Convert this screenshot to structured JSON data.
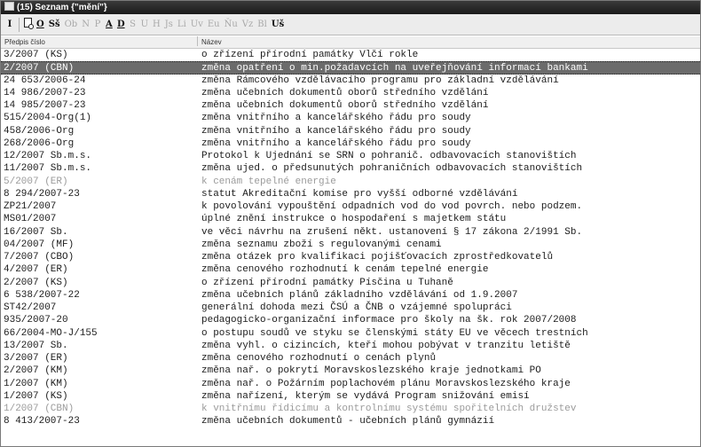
{
  "window": {
    "title": "(15) Seznam {\"mění\"}"
  },
  "toolbar": {
    "buttons": [
      {
        "label": "I",
        "active": true
      },
      {
        "label": "",
        "active": true,
        "icon": "document-search-icon"
      },
      {
        "label": "O",
        "active": true,
        "underline": true
      },
      {
        "label": "Sš",
        "active": true
      },
      {
        "label": "Ob",
        "active": false
      },
      {
        "label": "N",
        "active": false
      },
      {
        "label": "P",
        "active": false
      },
      {
        "label": "A",
        "active": true,
        "underline": true
      },
      {
        "label": "D",
        "active": true,
        "underline": true
      },
      {
        "label": "S",
        "active": false
      },
      {
        "label": "U",
        "active": false
      },
      {
        "label": "H",
        "active": false
      },
      {
        "label": "Js",
        "active": false
      },
      {
        "label": "Li",
        "active": false
      },
      {
        "label": "Uv",
        "active": false
      },
      {
        "label": "Eu",
        "active": false
      },
      {
        "label": "Ňu",
        "active": false
      },
      {
        "label": "Vz",
        "active": false
      },
      {
        "label": "Bl",
        "active": false
      },
      {
        "label": "Uš",
        "active": true
      }
    ]
  },
  "list": {
    "headers": [
      "Předpis číslo",
      "Název"
    ],
    "rows": [
      {
        "number": "3/2007 (KS)",
        "name": "o zřízení přírodní památky Vlčí rokle",
        "state": "normal"
      },
      {
        "number": "2/2007 (CBN)",
        "name": "změna opatření o min.požadavcích na uveřejňování informací bankami",
        "state": "selected"
      },
      {
        "number": "24 653/2006-24",
        "name": "změna Rámcového vzdělávacího programu pro základní vzdělávání",
        "state": "normal"
      },
      {
        "number": "14 986/2007-23",
        "name": "změna učebních dokumentů oborů středního vzdělání",
        "state": "normal"
      },
      {
        "number": "14 985/2007-23",
        "name": "změna učebních dokumentů oborů středního vzdělání",
        "state": "normal"
      },
      {
        "number": "515/2004-Org(1)",
        "name": "změna vnitřního a kancelářského řádu pro soudy",
        "state": "normal"
      },
      {
        "number": "458/2006-Org",
        "name": "změna vnitřního a kancelářského řádu pro soudy",
        "state": "normal"
      },
      {
        "number": "268/2006-Org",
        "name": "změna vnitřního a kancelářského řádu pro soudy",
        "state": "normal"
      },
      {
        "number": "12/2007 Sb.m.s.",
        "name": "Protokol k Ujednání se SRN o pohranič. odbavovacích stanovištích",
        "state": "normal"
      },
      {
        "number": "11/2007 Sb.m.s.",
        "name": "změna ujed. o předsunutých pohraničních odbavovacích stanovištích",
        "state": "normal"
      },
      {
        "number": "5/2007 (ER)",
        "name": "k cenám tepelné energie",
        "state": "dim"
      },
      {
        "number": "8 294/2007-23",
        "name": "statut Akreditační komise pro vyšší odborné vzdělávání",
        "state": "normal"
      },
      {
        "number": "ZP21/2007",
        "name": "k povolování vypouštění odpadních vod do vod povrch. nebo podzem.",
        "state": "normal"
      },
      {
        "number": "MS01/2007",
        "name": "úplné znění instrukce o hospodaření s majetkem státu",
        "state": "normal"
      },
      {
        "number": "16/2007 Sb.",
        "name": "ve věci návrhu na zrušení někt. ustanovení § 17 zákona 2/1991 Sb.",
        "state": "normal"
      },
      {
        "number": "04/2007 (MF)",
        "name": "změna seznamu zboží s regulovanými cenami",
        "state": "normal"
      },
      {
        "number": "7/2007 (CBO)",
        "name": "změna otázek pro kvalifikaci pojišťovacích zprostředkovatelů",
        "state": "normal"
      },
      {
        "number": "4/2007 (ER)",
        "name": "změna cenového rozhodnutí k cenám tepelné energie",
        "state": "normal"
      },
      {
        "number": "2/2007 (KS)",
        "name": "o zřízení přírodní památky Písčina u Tuhaně",
        "state": "normal"
      },
      {
        "number": "6 538/2007-22",
        "name": "změna učebních plánů základního vzdělávání od 1.9.2007",
        "state": "normal"
      },
      {
        "number": "ST42/2007",
        "name": "generální dohoda mezi ČSÚ a ČNB o vzájemné spolupráci",
        "state": "normal"
      },
      {
        "number": "935/2007-20",
        "name": "pedagogicko-organizační informace pro školy na šk. rok 2007/2008",
        "state": "normal"
      },
      {
        "number": "66/2004-MO-J/155",
        "name": "o postupu soudů ve styku se členskými státy EU ve věcech trestních",
        "state": "normal"
      },
      {
        "number": "13/2007 Sb.",
        "name": "změna vyhl. o cizincích, kteří mohou pobývat v tranzitu letiště",
        "state": "normal"
      },
      {
        "number": "3/2007 (ER)",
        "name": "změna cenového rozhodnutí o cenách plynů",
        "state": "normal"
      },
      {
        "number": "2/2007 (KM)",
        "name": "změna nař. o pokrytí Moravskoslezského kraje jednotkami PO",
        "state": "normal"
      },
      {
        "number": "1/2007 (KM)",
        "name": "změna nař. o Požárním poplachovém plánu Moravskoslezského kraje",
        "state": "normal"
      },
      {
        "number": "1/2007 (KS)",
        "name": "změna nařízení, kterým se vydává Program snižování emisí",
        "state": "normal"
      },
      {
        "number": "1/2007 (CBN)",
        "name": "k vnitřnímu řídicímu a kontrolnímu systému spořitelních družstev",
        "state": "dim"
      },
      {
        "number": "8 413/2007-23",
        "name": "změna učebních dokumentů - učebních plánů gymnázií",
        "state": "normal"
      }
    ]
  }
}
